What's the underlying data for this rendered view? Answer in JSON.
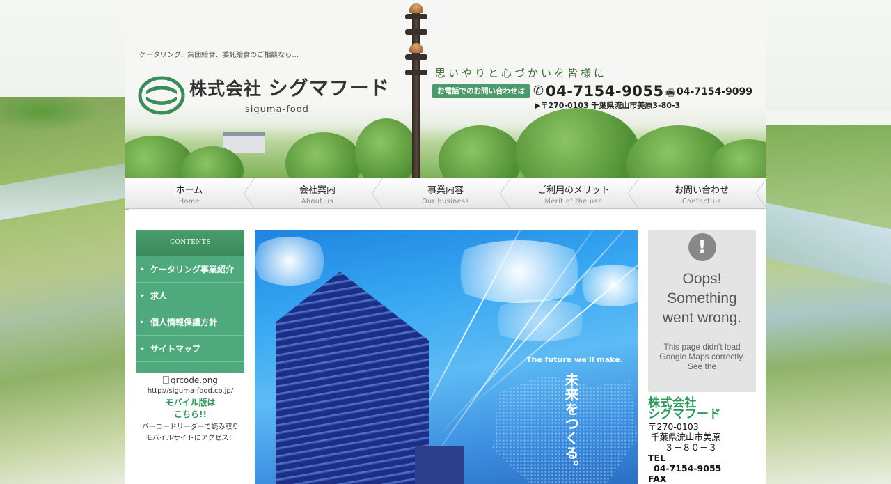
{
  "header": {
    "tagline": "ケータリング、集団給食、委託給食のご相談なら…",
    "company_prefix": "株式会社",
    "company_name": "シグマフード",
    "logo_sub": "siguma-food",
    "catch_copy": "思いやりと心づかいを皆様に",
    "tel_label": "お電話でのお問い合わせは",
    "tel_icon": "phone-icon",
    "tel": "04-7154-9055",
    "fax_icon": "fax-icon",
    "fax": "04-7154-9099",
    "address": "▶〒270-0103 千葉県流山市美原3-80-3"
  },
  "nav": [
    {
      "ja": "ホーム",
      "en": "Home"
    },
    {
      "ja": "会社案内",
      "en": "About us"
    },
    {
      "ja": "事業内容",
      "en": "Our business"
    },
    {
      "ja": "ご利用のメリット",
      "en": "Merit of the use"
    },
    {
      "ja": "お問い合わせ",
      "en": "Contact us"
    }
  ],
  "sidebar": {
    "heading": "CONTENTS",
    "items": [
      {
        "label": "ケータリング事業紹介"
      },
      {
        "label": "求人"
      },
      {
        "label": "個人情報保護方針"
      },
      {
        "label": "サイトマップ"
      }
    ],
    "qr_alt": "qrcode.png",
    "qr_url": "http://siguma-food.co.jp/",
    "mobile_line1": "モバイル版は",
    "mobile_line2": "こちら!!",
    "note_line1": "バーコードリーダーで読み取り",
    "note_line2": "モバイルサイトにアクセス！"
  },
  "hero": {
    "english": "The future we'll make.",
    "japanese": "未来をつくる。"
  },
  "map": {
    "icon": "exclamation-icon",
    "title": "Oops! Something went wrong.",
    "text": "This page didn't load Google Maps correctly. See the"
  },
  "company_info": {
    "name_line1": "株式会社",
    "name_line2": "シグマフード",
    "postal": "〒270-0103",
    "address_line1": "千葉県流山市美原",
    "address_line2": "３－８０－３",
    "tel_label": "TEL",
    "tel": "04-7154-9055",
    "fax_label": "FAX"
  }
}
